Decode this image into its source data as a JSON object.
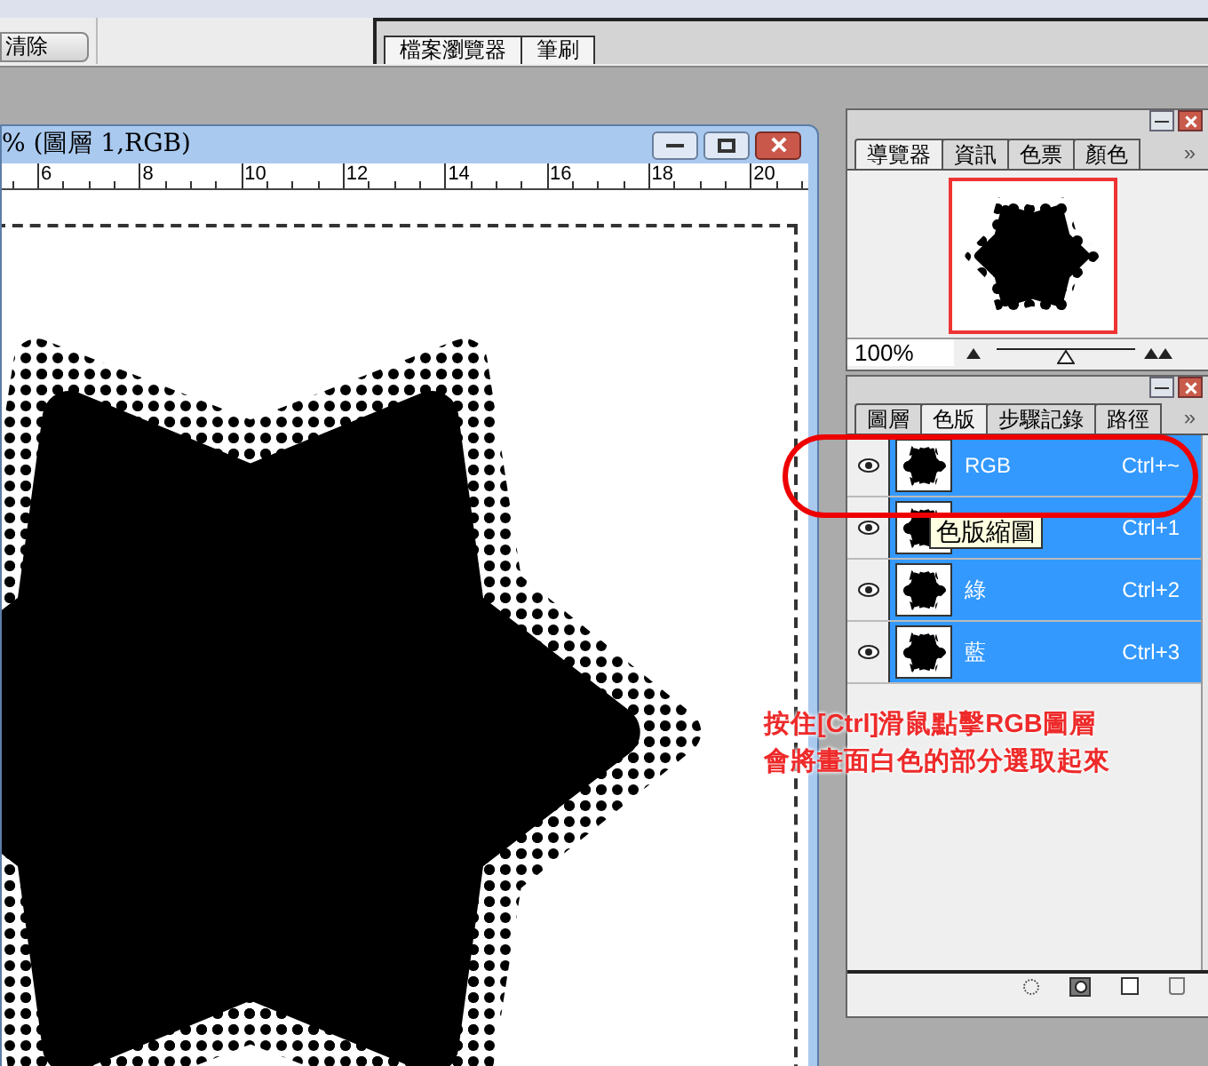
{
  "options_bar": {
    "clear_button": "清除"
  },
  "palette_well": {
    "tabs": [
      {
        "label": "檔案瀏覽器"
      },
      {
        "label": "筆刷"
      }
    ]
  },
  "document": {
    "title": "% (圖層 1,RGB)",
    "ruler_labels": [
      "6",
      "8",
      "10",
      "12",
      "14",
      "16",
      "18",
      "20"
    ]
  },
  "navigator": {
    "tabs": [
      {
        "label": "導覽器",
        "selected": true
      },
      {
        "label": "資訊",
        "selected": false
      },
      {
        "label": "色票",
        "selected": false
      },
      {
        "label": "顏色",
        "selected": false
      }
    ],
    "menu_arrow": "»",
    "zoom": "100%",
    "level": 0.5
  },
  "channels_palette": {
    "tabs": [
      {
        "label": "圖層",
        "selected": false
      },
      {
        "label": "色版",
        "selected": true
      },
      {
        "label": "步驟記錄",
        "selected": false
      },
      {
        "label": "路徑",
        "selected": false
      }
    ],
    "menu_arrow": "»",
    "channels": [
      {
        "name": "RGB",
        "shortcut": "Ctrl+~",
        "visible": true,
        "selected": true
      },
      {
        "shortcut": "Ctrl+1",
        "visible": true,
        "selected": true
      },
      {
        "name": "綠",
        "shortcut": "Ctrl+2",
        "visible": true,
        "selected": true
      },
      {
        "name": "藍",
        "shortcut": "Ctrl+3",
        "visible": true,
        "selected": true
      }
    ],
    "tooltip": "色版縮圖"
  },
  "annotation": {
    "lines": [
      "按住[Ctrl]滑鼠點擊RGB圖層",
      "會將畫面白色的部分選取起來"
    ]
  }
}
